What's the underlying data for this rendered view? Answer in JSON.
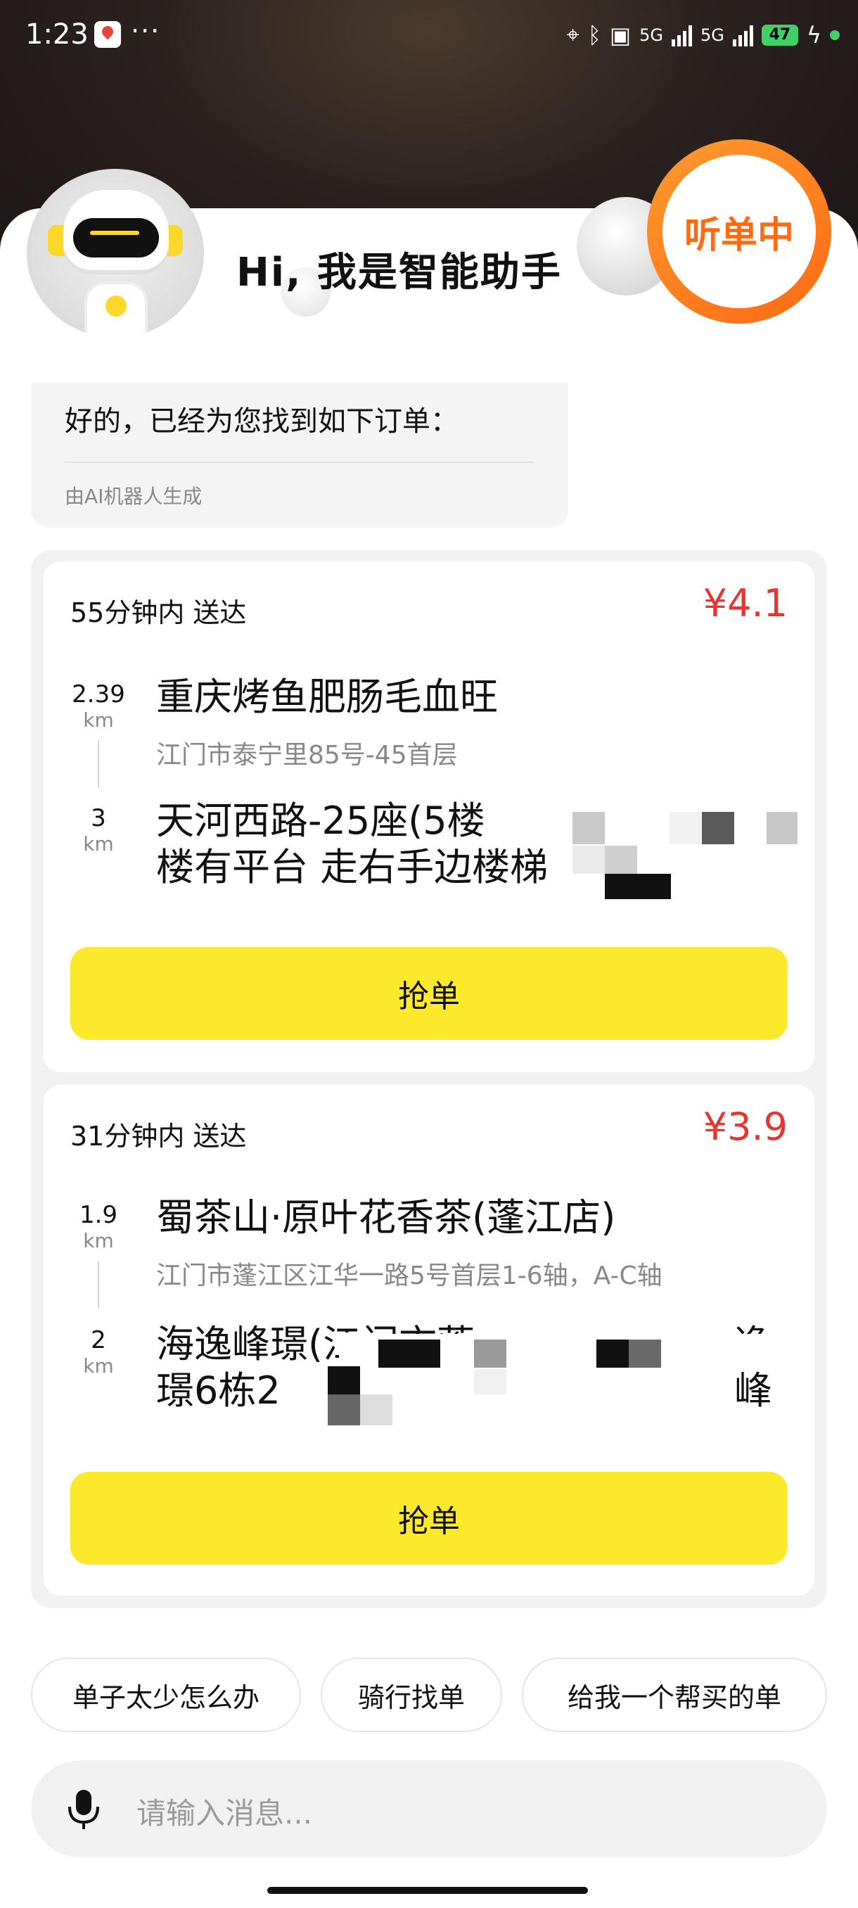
{
  "status_bar": {
    "time": "1:23",
    "more": "···",
    "network1": "5G",
    "network2": "5G",
    "battery": "47"
  },
  "header": {
    "greeting": "Hi, 我是智能助手",
    "listen_status": "听单中"
  },
  "assistant_reply": {
    "text": "好的，已经为您找到如下订单：",
    "note": "由AI机器人生成"
  },
  "orders": [
    {
      "deliver_time": "55分钟内 送达",
      "price": "¥4.1",
      "pickup": {
        "distance": "2.39",
        "unit": "km",
        "name": "重庆烤鱼肥肠毛血旺",
        "address": "江门市泰宁里85号-45首层"
      },
      "dropoff": {
        "distance": "3",
        "unit": "km",
        "line1": "天河西路-25座(5楼",
        "line2": "楼有平台 走右手边楼梯"
      },
      "action": "抢单"
    },
    {
      "deliver_time": "31分钟内 送达",
      "price": "¥3.9",
      "pickup": {
        "distance": "1.9",
        "unit": "km",
        "name": "蜀茶山·原叶花香茶(蓬江店)",
        "address": "江门市蓬江区江华一路5号首层1-6轴，A-C轴"
      },
      "dropoff": {
        "distance": "2",
        "unit": "km",
        "line1": "海逸峰璟(江门市蓬",
        "line1_tail": "逸峰",
        "line2": "璟6栋2"
      },
      "action": "抢单"
    }
  ],
  "quick_replies": [
    "单子太少怎么办",
    "骑行找单",
    "给我一个帮买的单"
  ],
  "input": {
    "placeholder": "请输入消息..."
  },
  "colors": {
    "accent_yellow": "#fde92b",
    "price_red": "#e8332f",
    "listen_orange": "#ff6a13"
  }
}
